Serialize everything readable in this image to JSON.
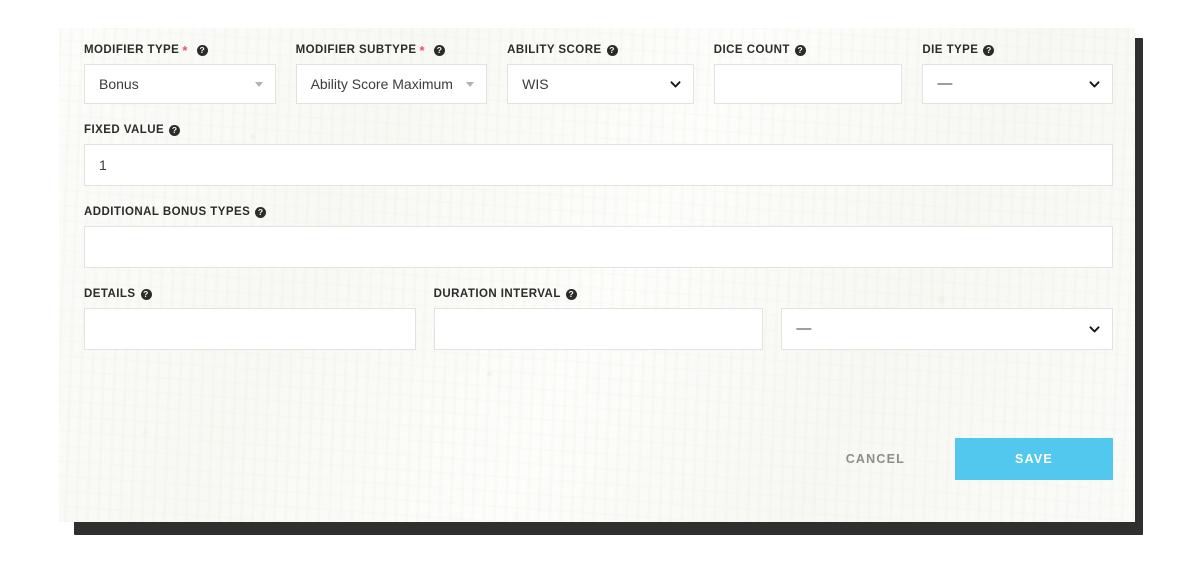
{
  "colors": {
    "accent": "#53c8ef",
    "required_star": "#e8507e",
    "panel_bg": "#faf9f6",
    "frame_shadow": "#2f2f2e",
    "label_text": "#2b2b2b",
    "cancel_text": "#8d8d8d",
    "field_border": "#e2e2de"
  },
  "icons": {
    "help": "?",
    "required": "*",
    "caret_triangle": "caret-down-triangle-icon",
    "caret_chevron": "chevron-down-icon"
  },
  "form": {
    "row1": {
      "modifier_type": {
        "label": "MODIFIER TYPE",
        "required": true,
        "value": "Bonus",
        "control": "dropdown-triangle"
      },
      "modifier_subtype": {
        "label": "MODIFIER SUBTYPE",
        "required": true,
        "value": "Ability Score Maximum",
        "control": "dropdown-triangle"
      },
      "ability_score": {
        "label": "ABILITY SCORE",
        "required": false,
        "value": "WIS",
        "control": "select-chevron"
      },
      "dice_count": {
        "label": "DICE COUNT",
        "required": false,
        "value": "",
        "placeholder": "",
        "control": "text"
      },
      "die_type": {
        "label": "DIE TYPE",
        "required": false,
        "value": "—",
        "control": "select-chevron"
      }
    },
    "row2": {
      "fixed_value": {
        "label": "FIXED VALUE",
        "required": false,
        "value": "1",
        "placeholder": "",
        "control": "text"
      }
    },
    "row3": {
      "additional_bonus_types": {
        "label": "ADDITIONAL BONUS TYPES",
        "required": false,
        "value": "",
        "placeholder": "",
        "control": "text"
      }
    },
    "row4": {
      "details": {
        "label": "DETAILS",
        "required": false,
        "value": "",
        "placeholder": "",
        "control": "text"
      },
      "duration_interval": {
        "label": "DURATION INTERVAL",
        "required": false,
        "value": "",
        "placeholder": "",
        "control": "text"
      },
      "duration_unit": {
        "label": "",
        "required": false,
        "value": "—",
        "control": "select-chevron"
      }
    }
  },
  "actions": {
    "cancel_label": "CANCEL",
    "save_label": "SAVE"
  }
}
